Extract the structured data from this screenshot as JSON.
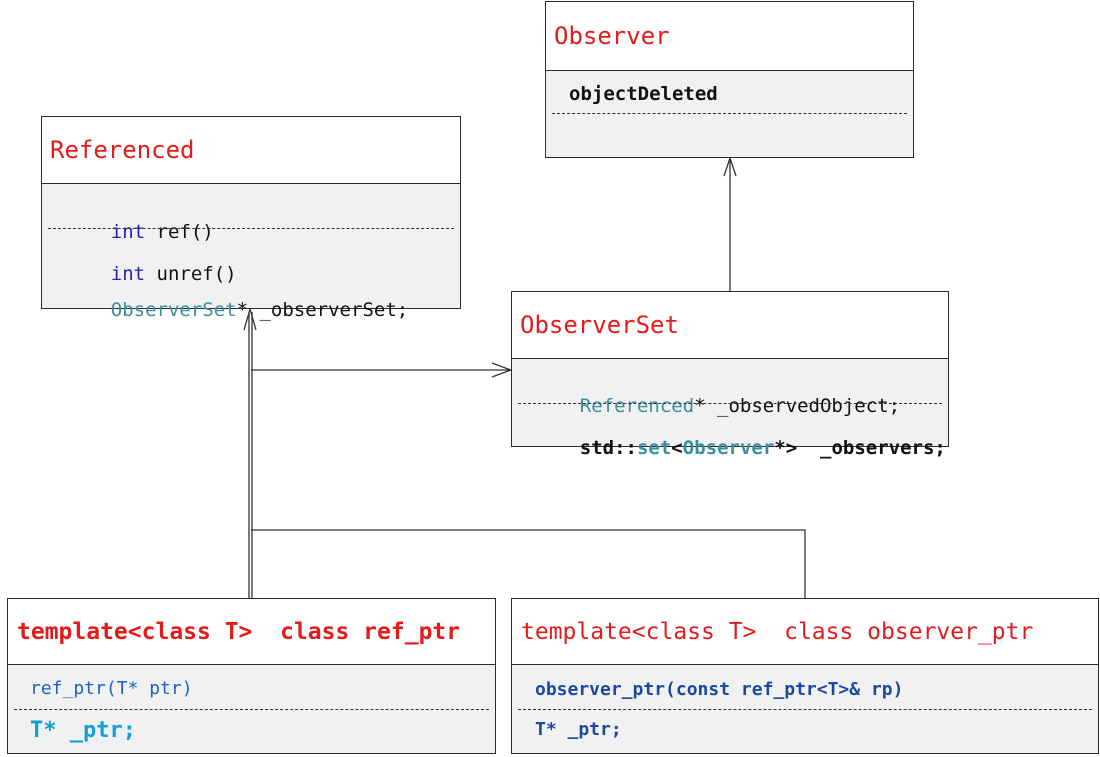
{
  "observer": {
    "title": "Observer",
    "members": [
      "objectDeleted"
    ]
  },
  "referenced": {
    "title": "Referenced",
    "method1": {
      "kw": "int",
      "rest": " ref()"
    },
    "method2": {
      "kw": "int",
      "rest": " unref()"
    },
    "field": {
      "type": "ObserverSet",
      "rest": "* _observerSet;"
    }
  },
  "observer_set": {
    "title": "ObserverSet",
    "field1": {
      "type": "Referenced",
      "rest": "* _observedObject;"
    },
    "field2": {
      "p1": "std::",
      "p2": "set",
      "p3": "<",
      "p4": "Observer",
      "p5": "*>  _observers;"
    }
  },
  "ref_ptr": {
    "title": "template<class T>  class ref_ptr",
    "ctor": "ref_ptr(T* ptr)",
    "field": "T* _ptr;"
  },
  "observer_ptr": {
    "title": "template<class T>  class observer_ptr",
    "ctor": "observer_ptr(const ref_ptr<T>& rp)",
    "field": "T* _ptr;"
  },
  "colors": {
    "title_red": "#e31b1b",
    "keyword_blue": "#1f1fb5",
    "type_teal": "#3a8e9e",
    "compartment_bg": "#f1f1f1",
    "ref_ptr_cyan": "#11a0d8"
  }
}
